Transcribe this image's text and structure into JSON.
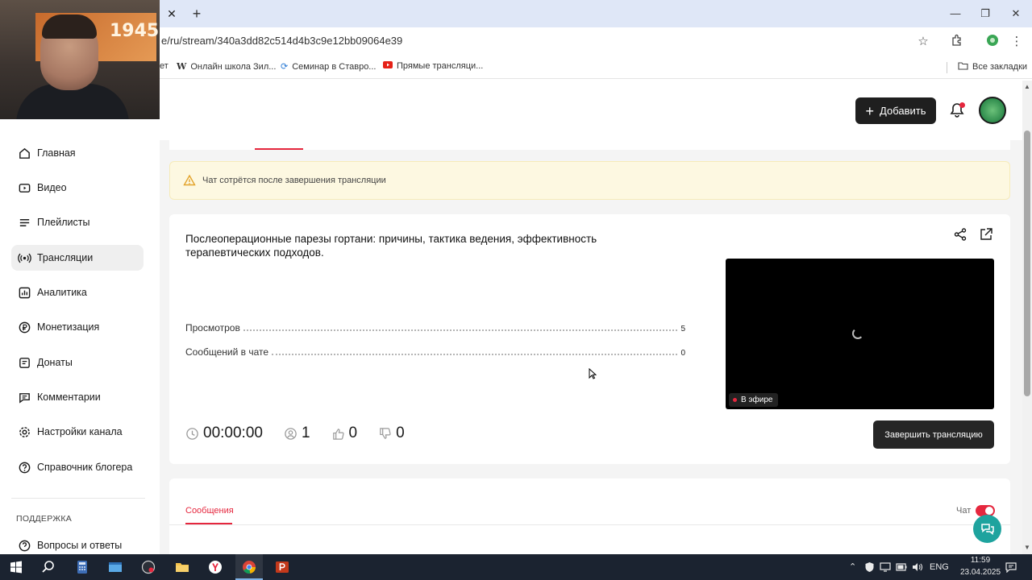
{
  "browser": {
    "url": "e/ru/stream/340a3dd82c514d4b3c9e12bb09064e39",
    "bookmarks": [
      {
        "label": "ет",
        "icon": "bookmark-partial"
      },
      {
        "label": "Онлайн школа Зил...",
        "icon": "w-icon"
      },
      {
        "label": "Семинар в Ставро...",
        "icon": "link-icon"
      },
      {
        "label": "Прямые трансляци...",
        "icon": "youtube-icon"
      }
    ],
    "all_bookmarks": "Все закладки"
  },
  "webcam": {
    "banner_text": "1945"
  },
  "header": {
    "add_label": "Добавить"
  },
  "sidebar": {
    "items": [
      {
        "label": "Главная",
        "icon": "home-icon"
      },
      {
        "label": "Видео",
        "icon": "video-icon"
      },
      {
        "label": "Плейлисты",
        "icon": "playlist-icon"
      },
      {
        "label": "Трансляции",
        "icon": "broadcast-icon",
        "active": true
      },
      {
        "label": "Аналитика",
        "icon": "analytics-icon"
      },
      {
        "label": "Монетизация",
        "icon": "ruble-icon"
      },
      {
        "label": "Донаты",
        "icon": "donate-icon"
      },
      {
        "label": "Комментарии",
        "icon": "comment-icon"
      },
      {
        "label": "Настройки канала",
        "icon": "gear-icon"
      },
      {
        "label": "Справочник блогера",
        "icon": "help-icon"
      }
    ],
    "section_label": "ПОДДЕРЖКА",
    "support_item": {
      "label": "Вопросы и ответы",
      "icon": "faq-icon"
    }
  },
  "warning": {
    "text": "Чат сотрётся после завершения трансляции"
  },
  "stream": {
    "title": "Послеоперационные парезы гортани: причины, тактика ведения, эффективность терапевтических подходов.",
    "stats": [
      {
        "label": "Просмотров",
        "value": "5"
      },
      {
        "label": "Сообщений в чате",
        "value": "0"
      }
    ],
    "metrics": {
      "duration": "00:00:00",
      "viewers": "1",
      "likes": "0",
      "dislikes": "0"
    },
    "live_label": "В эфире",
    "end_button": "Завершить трансляцию"
  },
  "chat": {
    "tab_label": "Сообщения",
    "toggle_label": "Чат",
    "toggle_on": true
  },
  "taskbar": {
    "lang": "ENG",
    "time": "11:59",
    "date": "23.04.2025"
  },
  "colors": {
    "accent": "#e5273e",
    "dark_button": "#1f1f1f",
    "help_fab": "#1ea39e"
  }
}
